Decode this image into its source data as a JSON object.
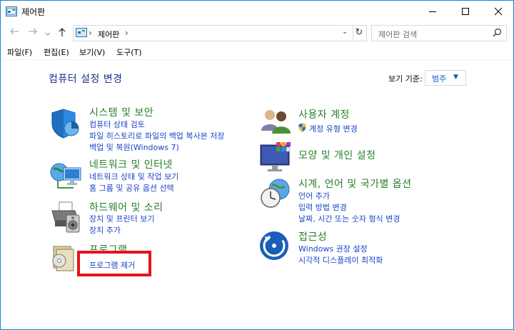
{
  "window": {
    "title": "제어판"
  },
  "address": {
    "crumb": "제어판"
  },
  "search": {
    "placeholder": "제어판 검색"
  },
  "menu": [
    "파일(F)",
    "편집(E)",
    "보기(V)",
    "도구(T)"
  ],
  "main": {
    "heading": "컴퓨터 설정 변경",
    "view_by_label": "보기 기준:",
    "view_by_value": "범주",
    "left": [
      {
        "title": "시스템 및 보안",
        "links": [
          "컴퓨터 상태 검토",
          "파일 히스토리로 파일의 백업 복사본 저장",
          "백업 및 복원(Windows 7)"
        ]
      },
      {
        "title": "네트워크 및 인터넷",
        "links": [
          "네트워크 상태 및 작업 보기",
          "홈 그룹 및 공유 옵션 선택"
        ]
      },
      {
        "title": "하드웨어 및 소리",
        "links": [
          "장치 및 프린터 보기",
          "장치 추가"
        ]
      },
      {
        "title": "프로그램",
        "links": [
          "프로그램 제거"
        ]
      }
    ],
    "right": [
      {
        "title": "사용자 계정",
        "links": [
          "계정 유형 변경"
        ]
      },
      {
        "title": "모양 및 개인 설정",
        "links": []
      },
      {
        "title": "시계, 언어 및 국가별 옵션",
        "links": [
          "언어 추가",
          "입력 방법 변경",
          "날짜, 시간 또는 숫자 형식 변경"
        ]
      },
      {
        "title": "접근성",
        "links": [
          "Windows 권장 설정",
          "시각적 디스플레이 최적화"
        ]
      }
    ]
  },
  "colors": {
    "accent": "#1883d7",
    "heading": "#1e3287",
    "category": "#287e28",
    "link": "#1d46c8",
    "highlight": "#e4141c"
  }
}
